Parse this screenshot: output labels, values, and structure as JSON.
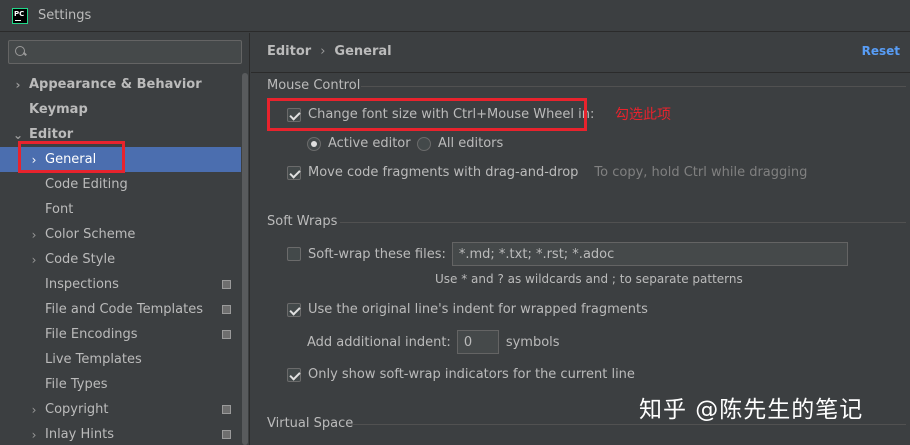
{
  "window": {
    "title": "Settings",
    "app_icon_text": "PC"
  },
  "search": {
    "placeholder": "",
    "value": ""
  },
  "sidebar": {
    "items": [
      {
        "label": "Appearance & Behavior",
        "level": 0,
        "arrow": "›",
        "bold": true
      },
      {
        "label": "Keymap",
        "level": 0,
        "arrow": "",
        "bold": true
      },
      {
        "label": "Editor",
        "level": 0,
        "arrow": "⌄",
        "bold": true
      },
      {
        "label": "General",
        "level": 1,
        "arrow": "›",
        "selected": true
      },
      {
        "label": "Code Editing",
        "level": 1,
        "arrow": ""
      },
      {
        "label": "Font",
        "level": 1,
        "arrow": ""
      },
      {
        "label": "Color Scheme",
        "level": 1,
        "arrow": "›"
      },
      {
        "label": "Code Style",
        "level": 1,
        "arrow": "›"
      },
      {
        "label": "Inspections",
        "level": 1,
        "arrow": "",
        "project_icon": true
      },
      {
        "label": "File and Code Templates",
        "level": 1,
        "arrow": "",
        "project_icon": true
      },
      {
        "label": "File Encodings",
        "level": 1,
        "arrow": "",
        "project_icon": true
      },
      {
        "label": "Live Templates",
        "level": 1,
        "arrow": ""
      },
      {
        "label": "File Types",
        "level": 1,
        "arrow": ""
      },
      {
        "label": "Copyright",
        "level": 1,
        "arrow": "›",
        "project_icon": true
      },
      {
        "label": "Inlay Hints",
        "level": 1,
        "arrow": "›",
        "project_icon": true
      }
    ]
  },
  "header": {
    "crumb1": "Editor",
    "separator": "›",
    "crumb2": "General",
    "reset_label": "Reset"
  },
  "mouse_control": {
    "title": "Mouse Control",
    "change_font_label": "Change font size with Ctrl+Mouse Wheel in:",
    "change_font_checked": true,
    "active_editor_label": "Active editor",
    "all_editors_label": "All editors",
    "selected_radio": "active",
    "drag_drop_label": "Move code fragments with drag-and-drop",
    "drag_drop_checked": true,
    "drag_drop_hint": "To copy, hold Ctrl while dragging"
  },
  "annotation": {
    "text": "勾选此项"
  },
  "soft_wraps": {
    "title": "Soft Wraps",
    "soft_wrap_label": "Soft-wrap these files:",
    "soft_wrap_checked": false,
    "soft_wrap_value": "*.md; *.txt; *.rst; *.adoc",
    "wildcard_hint": "Use * and ? as wildcards and ; to separate patterns",
    "original_indent_label": "Use the original line's indent for wrapped fragments",
    "original_indent_checked": true,
    "additional_indent_label": "Add additional indent:",
    "additional_indent_value": "0",
    "symbols_label": "symbols",
    "only_current_label": "Only show soft-wrap indicators for the current line",
    "only_current_checked": true
  },
  "virtual_space": {
    "title": "Virtual Space"
  },
  "watermark": {
    "text": "知乎 @陈先生的笔记"
  }
}
